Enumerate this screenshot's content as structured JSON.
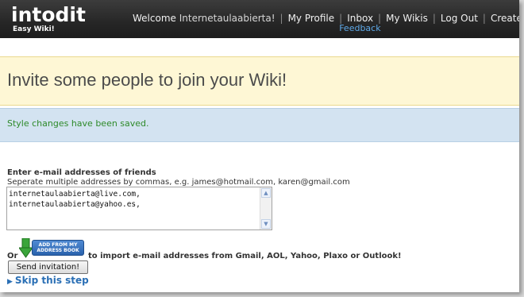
{
  "header": {
    "logo_text": "intodit",
    "tagline": "Easy Wiki!",
    "welcome_prefix": "Welcome",
    "username": "Internetaulaabierta!",
    "nav": {
      "my_profile": "My Profile",
      "inbox": "Inbox",
      "feedback": "Feedback",
      "my_wikis": "My Wikis",
      "log_out": "Log Out",
      "create_wiki": "Create Wiki"
    },
    "separator": "|"
  },
  "page": {
    "title": "Invite some people to join your Wiki!",
    "success_message": "Style changes have been saved."
  },
  "form": {
    "label": "Enter e-mail addresses of friends",
    "hint": "Seperate multiple addresses by commas, e.g. james@hotmail.com, karen@gmail.com",
    "emails_value": "internetaulaabierta@live.com,\ninternetaulaabierta@yahoo.es,",
    "or_label": "Or",
    "address_book_line1": "ADD FROM MY",
    "address_book_line2": "ADDRESS BOOK",
    "import_text": "to import e-mail addresses from Gmail, AOL, Yahoo, Plaxo or Outlook!",
    "send_button": "Send invitation!",
    "skip_link": "Skip this step"
  },
  "colors": {
    "header_bg": "#262626",
    "logo_dot": "#e8c21a",
    "feedback_link": "#5fa9e8",
    "title_band_bg": "#fef7d5",
    "message_band_bg": "#d3e3f1",
    "success_text": "#2e8a2a",
    "link": "#2a6fb5"
  }
}
